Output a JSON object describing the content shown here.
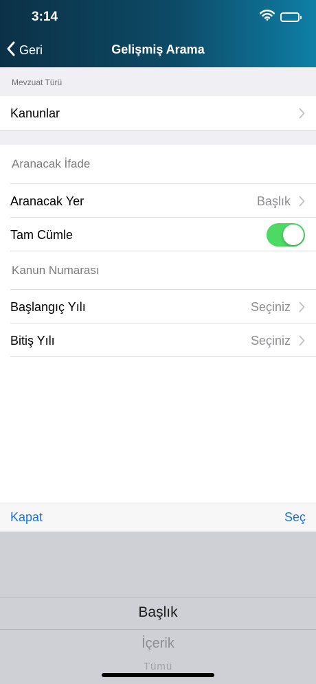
{
  "status_bar": {
    "time": "3:14"
  },
  "nav": {
    "back_label": "Geri",
    "title": "Gelişmiş Arama"
  },
  "section_type": {
    "header": "Mevzuat Türü",
    "value": "Kanunlar"
  },
  "search": {
    "phrase_placeholder": "Aranacak İfade",
    "location_label": "Aranacak Yer",
    "location_value": "Başlık",
    "full_sentence_label": "Tam Cümle",
    "full_sentence_on": true,
    "law_number_placeholder": "Kanun Numarası",
    "start_year_label": "Başlangıç Yılı",
    "start_year_value": "Seçiniz",
    "end_year_label": "Bitiş Yılı",
    "end_year_value": "Seçiniz"
  },
  "picker_toolbar": {
    "close_label": "Kapat",
    "select_label": "Seç"
  },
  "picker": {
    "options": [
      "Başlık",
      "İçerik",
      "Tümü"
    ],
    "selected": "Başlık"
  },
  "colors": {
    "accent": "#1a73d9",
    "toggle_on": "#4cd964",
    "header_start": "#0b3146",
    "header_end": "#0f7fa6"
  }
}
